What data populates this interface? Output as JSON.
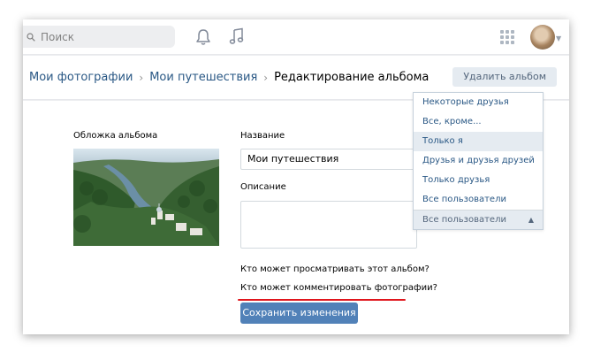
{
  "header": {
    "search": {
      "placeholder": "Поиск",
      "icon": "search-icon"
    },
    "icons": [
      "bell-icon",
      "music-icon",
      "apps-grid-icon"
    ]
  },
  "breadcrumb": {
    "items": [
      "Мои фотографии",
      "Мои путешествия"
    ],
    "current": "Редактирование альбома"
  },
  "actions": {
    "delete_label": "Удалить альбом",
    "save_label": "Сохранить изменения"
  },
  "form": {
    "cover_label": "Обложка альбома",
    "name_label": "Название",
    "name_value": "Мои путешествия",
    "description_label": "Описание",
    "description_value": "",
    "view_question": "Кто может просматривать этот альбом?",
    "comment_question": "Кто может комментировать фотографии?"
  },
  "privacy_dropdown": {
    "options": [
      "Некоторые друзья",
      "Все, кроме...",
      "Только я",
      "Друзья и друзья друзей",
      "Только друзья",
      "Все пользователи"
    ],
    "hovered": "Только я",
    "selected": "Все пользователи"
  },
  "colors": {
    "accent": "#5181b8",
    "link": "#2a5885",
    "highlight_underline": "#e0161d",
    "page_bg": "#edeef0"
  }
}
